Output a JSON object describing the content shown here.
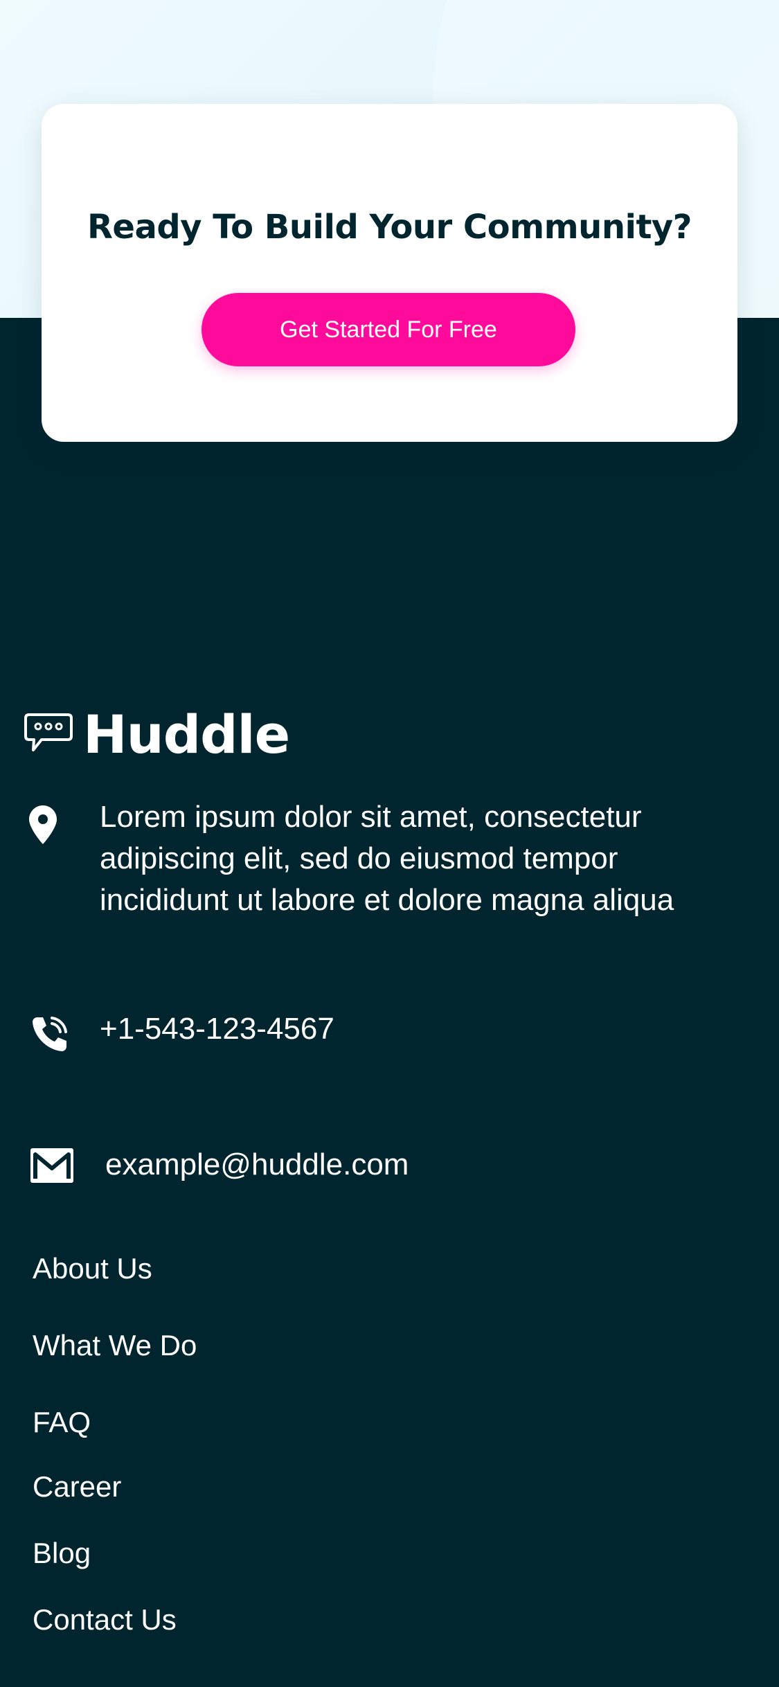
{
  "cta": {
    "title": "Ready To Build Your Community?",
    "button_label": "Get Started For Free"
  },
  "brand": {
    "name": "Huddle",
    "icon": "chat-bubble-icon"
  },
  "contact": {
    "address": "Lorem ipsum dolor sit amet, consectetur adipiscing elit, sed do eiusmod tempor incididunt ut labore et dolore magna aliqua",
    "address_icon": "location-pin-icon",
    "phone": "+1-543-123-4567",
    "phone_icon": "phone-icon",
    "email": "example@huddle.com",
    "email_icon": "mail-icon"
  },
  "footer_links": {
    "about": "About Us",
    "what_we_do": "What We Do",
    "faq": "FAQ",
    "career": "Career",
    "blog": "Blog",
    "contact": "Contact Us"
  },
  "colors": {
    "accent": "#ff0b9b",
    "footer_bg": "#00252e",
    "hero_bg": "#f0fbfe"
  }
}
